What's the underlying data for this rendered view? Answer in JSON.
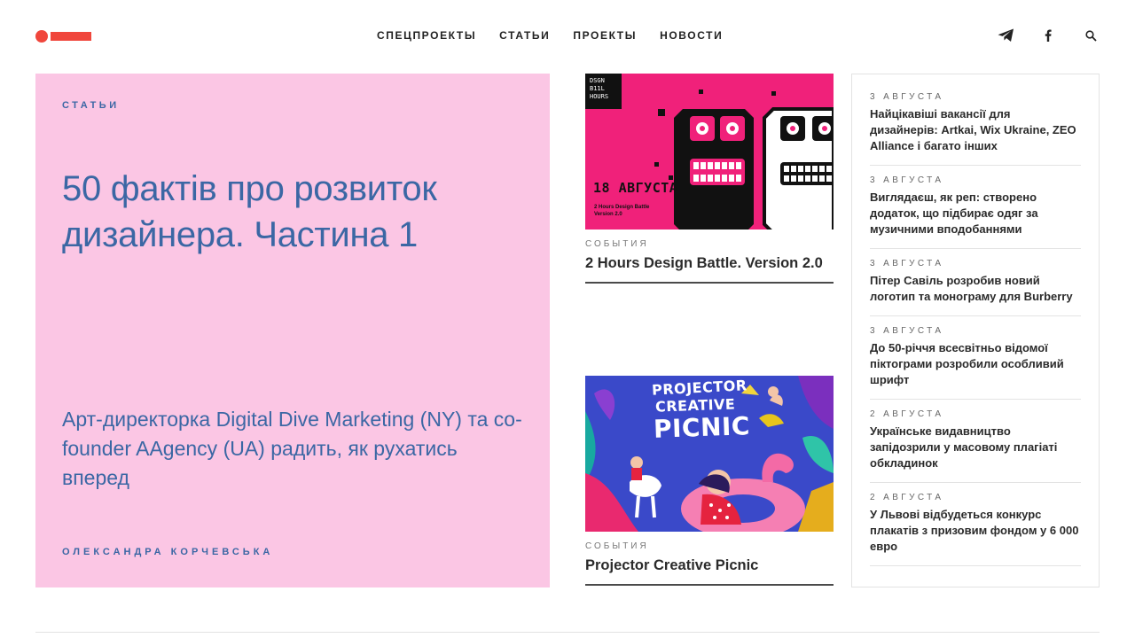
{
  "header": {
    "nav": [
      "СПЕЦПРОЕКТЫ",
      "СТАТЬИ",
      "ПРОЕКТЫ",
      "НОВОСТИ"
    ],
    "icons": [
      "telegram-icon",
      "facebook-icon",
      "search-icon"
    ]
  },
  "hero": {
    "category": "СТАТЬИ",
    "title": "50 фактів про розвиток дизайнера. Частина 1",
    "subtitle": "Арт-директорка Digital Dive Marketing (NY) та co-founder AAgency (UA) радить, як рухатись вперед",
    "author": "ОЛЕКСАНДРА КОРЧЕВСЬКА"
  },
  "cards": [
    {
      "label": "СОБЫТИЯ",
      "title": "2 Hours Design Battle. Version 2.0",
      "image": {
        "badge_lines": [
          "DSGN",
          "B11L",
          "HOURS"
        ],
        "date": "18 АВГУСТА",
        "caption1": "2 Hours Design Battle",
        "caption2": "Version 2.0"
      }
    },
    {
      "label": "СОБЫТИЯ",
      "title": "Projector Creative Picnic",
      "image": {
        "line1": "PROJECTOR",
        "line2": "CREATIVE",
        "line3": "PICNIC"
      }
    }
  ],
  "sidebar": [
    {
      "date": "3 АВГУСТА",
      "title": "Найцікавіші вакансії для дизайнерів: Artkai, Wix Ukraine, ZEO Alliance і багато інших"
    },
    {
      "date": "3 АВГУСТА",
      "title": "Виглядаєш, як реп: створено додаток, що підбирає одяг за музичними вподобаннями"
    },
    {
      "date": "3 АВГУСТА",
      "title": "Пітер Савіль розробив новий логотип та монограму для Burberry"
    },
    {
      "date": "3 АВГУСТА",
      "title": "До 50-річчя всесвітньо відомої піктограми розробили особливий шрифт"
    },
    {
      "date": "2 АВГУСТА",
      "title": "Українське видавництво запідозрили у масовому плагіаті обкладинок"
    },
    {
      "date": "2 АВГУСТА",
      "title": "У Львові відбудеться конкурс плакатів з призовим фондом у 6 000 евро"
    }
  ],
  "colors": {
    "accent": "#f0463c",
    "hero_bg": "#fbc6e4",
    "hero_text": "#3b67a4",
    "battle_pink": "#f0217a"
  }
}
